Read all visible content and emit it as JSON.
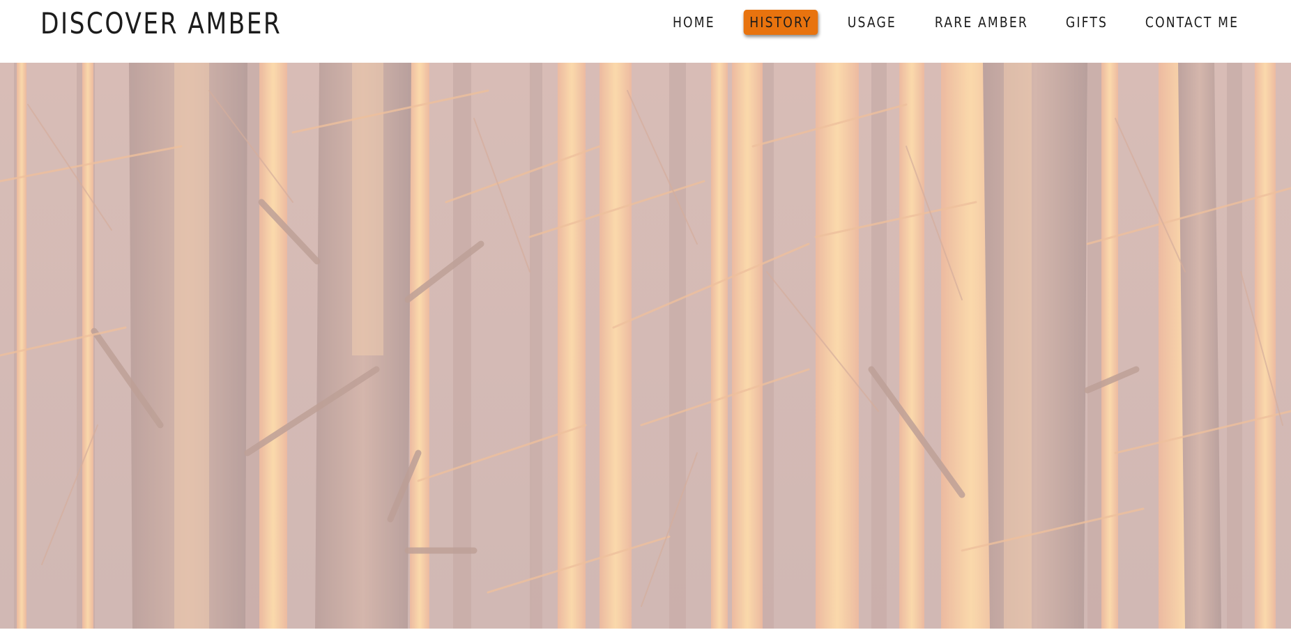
{
  "site": {
    "title": "DISCOVER AMBER"
  },
  "nav": {
    "items": [
      {
        "label": "HOME",
        "active": false
      },
      {
        "label": "HISTORY",
        "active": true
      },
      {
        "label": "USAGE",
        "active": false
      },
      {
        "label": "RARE AMBER",
        "active": false
      },
      {
        "label": "GIFTS",
        "active": false
      },
      {
        "label": "CONTACT ME",
        "active": false
      }
    ]
  },
  "hero": {
    "image": "pine-forest-sunset-photo"
  },
  "colors": {
    "accent": "#e8730e",
    "text": "#1c1c1c",
    "background": "#ffffff"
  }
}
